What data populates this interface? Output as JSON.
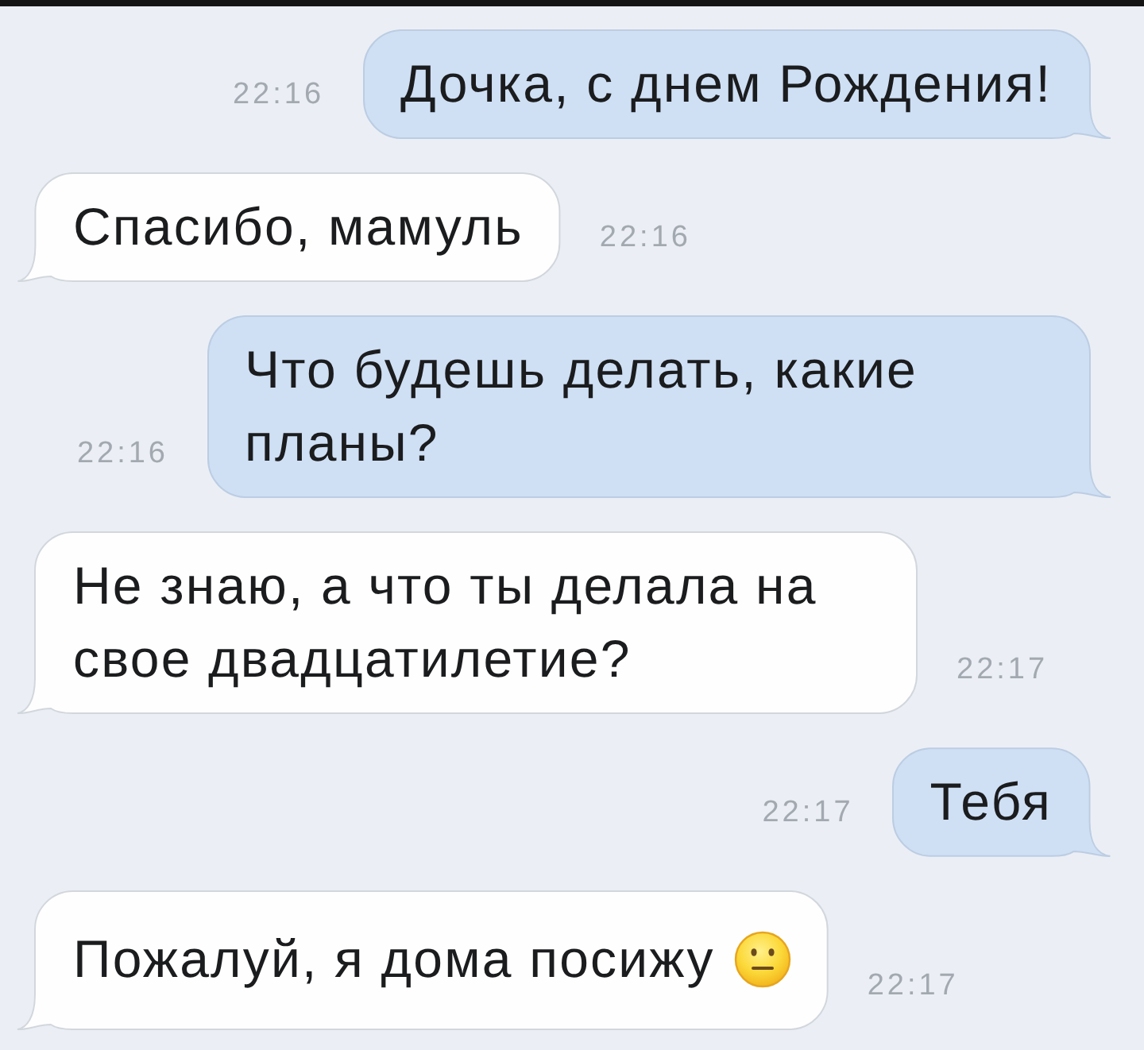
{
  "messages": [
    {
      "kind": "outgoing",
      "text": "Дочка, с днем Рождения!",
      "emoji": false,
      "time": "22:16"
    },
    {
      "kind": "incoming",
      "text": "Спасибо, мамуль",
      "emoji": false,
      "time": "22:16"
    },
    {
      "kind": "outgoing",
      "text": "Что будешь делать, какие планы?",
      "emoji": false,
      "time": "22:16"
    },
    {
      "kind": "incoming",
      "text": "Не знаю, а что ты делала на свое двадцатилетие?",
      "emoji": false,
      "time": "22:17"
    },
    {
      "kind": "outgoing",
      "text": "Тебя",
      "emoji": false,
      "time": "22:17"
    },
    {
      "kind": "incoming",
      "text": "Пожалуй, я дома посижу",
      "emoji": true,
      "time": "22:17"
    }
  ]
}
